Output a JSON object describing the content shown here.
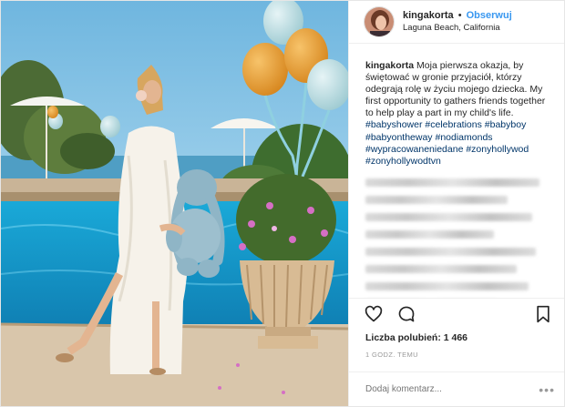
{
  "post": {
    "username": "kingakorta",
    "separator": "•",
    "follow_label": "Obserwuj",
    "location": "Laguna Beach, California"
  },
  "caption": {
    "username": "kingakorta",
    "text": "Moja pierwsza okazja, by świętować w gronie przyjaciół, którzy odegrają rolę w życiu mojego dziecka. My first opportunity to gathers friends together to help play a part in my child's life.",
    "hashtags": [
      "#babyshower",
      "#celebrations",
      "#babyboy",
      "#babyontheway",
      "#nodiamonds",
      "#wypracowaneniedane",
      "#zonyhollywod",
      "#zonyhollywodtvn"
    ]
  },
  "blurred_comments": [
    {
      "width": 0.92
    },
    {
      "width": 0.75
    },
    {
      "width": 0.88
    },
    {
      "width": 0.68
    },
    {
      "width": 0.9
    },
    {
      "width": 0.8
    },
    {
      "width": 0.86
    },
    {
      "width": 0.7
    },
    {
      "width": 0.78
    },
    {
      "width": 0.62
    },
    {
      "width": 0.5
    }
  ],
  "actions": {
    "like_icon": "heart-icon",
    "comment_icon": "comment-icon",
    "save_icon": "bookmark-icon"
  },
  "likes_text": "Liczba polubień: 1 466",
  "timestamp": "1 GODZ. TEMU",
  "comment_placeholder": "Dodaj komentarz...",
  "more_label": "•••",
  "colors": {
    "link": "#3897f0",
    "hashtag": "#003569",
    "muted": "#999999",
    "border": "#efefef"
  }
}
